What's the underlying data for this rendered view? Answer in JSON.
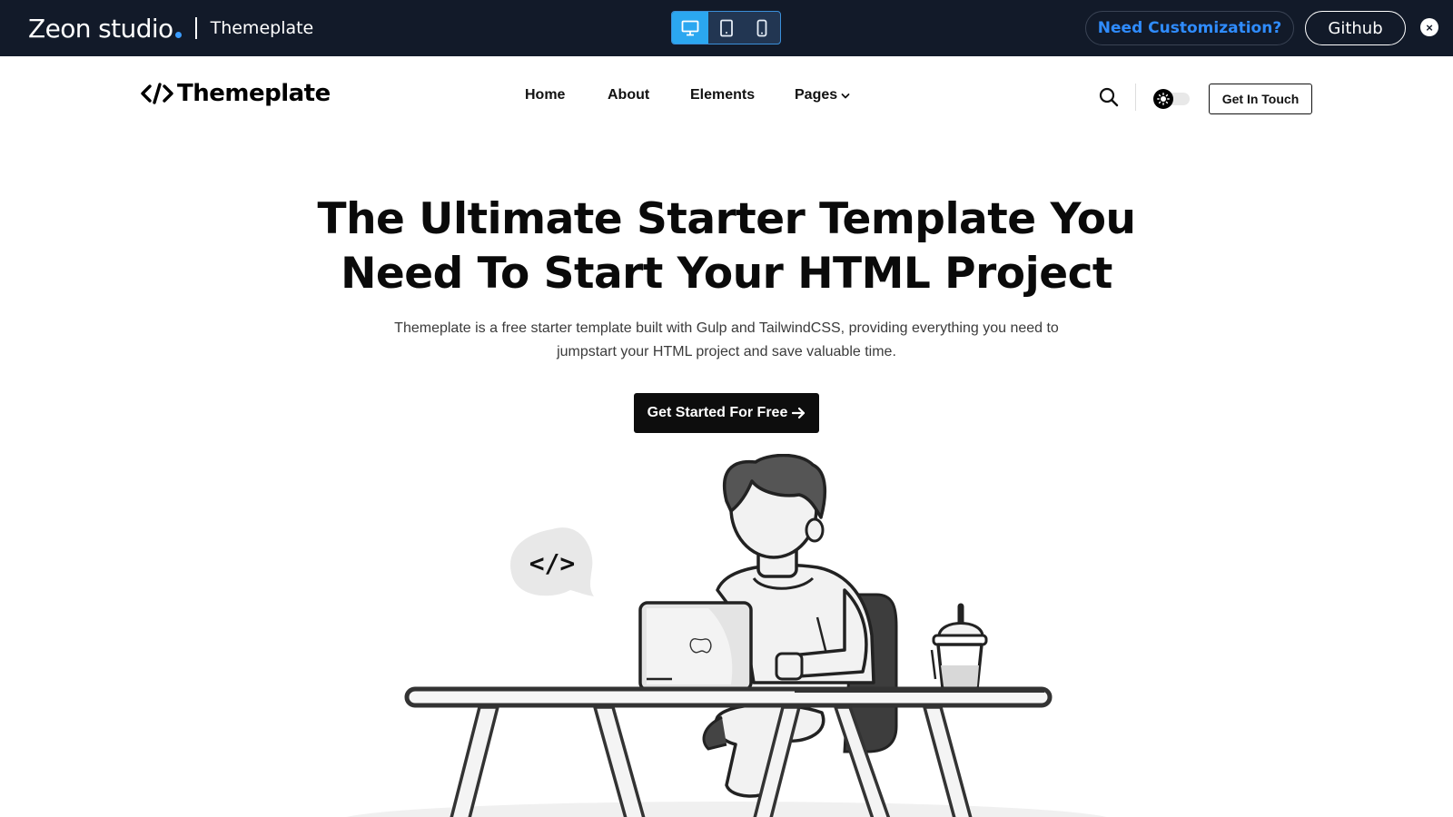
{
  "demo_bar": {
    "brand": "Zeon studio",
    "product": "Themeplate",
    "devices": [
      "desktop-icon",
      "tablet-icon",
      "mobile-icon"
    ],
    "active_device": "desktop",
    "customization_label": "Need Customization?",
    "github_label": "Github",
    "close_symbol": "×",
    "colors": {
      "bar_bg": "#121a29",
      "accent": "#2f8cff",
      "active_device_bg": "#2ba7f0"
    }
  },
  "header": {
    "logo_text": "Themeplate",
    "logo_icon": "code-brackets-icon",
    "nav": [
      {
        "label": "Home"
      },
      {
        "label": "About"
      },
      {
        "label": "Elements"
      },
      {
        "label": "Pages",
        "has_dropdown": true
      }
    ],
    "search_icon": "search-icon",
    "theme_toggle_icon": "sun-icon",
    "cta_label": "Get In Touch"
  },
  "hero": {
    "title_line1": "The Ultimate Starter Template You",
    "title_line2": "Need To Start Your HTML Project",
    "subtitle_line1": "Themeplate is a free starter template built with Gulp and TailwindCSS, providing everything you need to",
    "subtitle_line2": "jumpstart your HTML project and save valuable time.",
    "cta_label": "Get Started For Free",
    "cta_icon": "arrow-right-icon",
    "illustration_bubble_text": "</>",
    "illustration": "developer-at-desk-illustration"
  }
}
